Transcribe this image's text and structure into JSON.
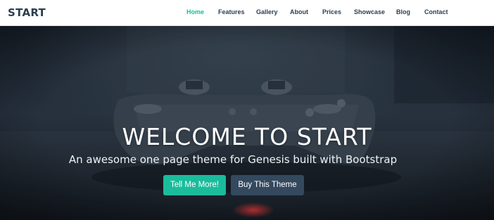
{
  "brand": "START",
  "nav": [
    {
      "label": "Home",
      "active": true
    },
    {
      "label": "Features",
      "active": false
    },
    {
      "label": "Gallery",
      "active": false
    },
    {
      "label": "About",
      "active": false
    },
    {
      "label": "Prices",
      "active": false
    },
    {
      "label": "Showcase",
      "active": false
    },
    {
      "label": "Blog",
      "active": false
    },
    {
      "label": "Contact",
      "active": false
    }
  ],
  "hero": {
    "title": "WELCOME TO START",
    "subtitle": "An awesome one page theme for Genesis built with Bootstrap",
    "primary_button": "Tell Me More!",
    "secondary_button": "Buy This Theme"
  },
  "colors": {
    "accent": "#1abc9c",
    "dark": "#2d3e50",
    "secondary_button": "#34495e"
  }
}
